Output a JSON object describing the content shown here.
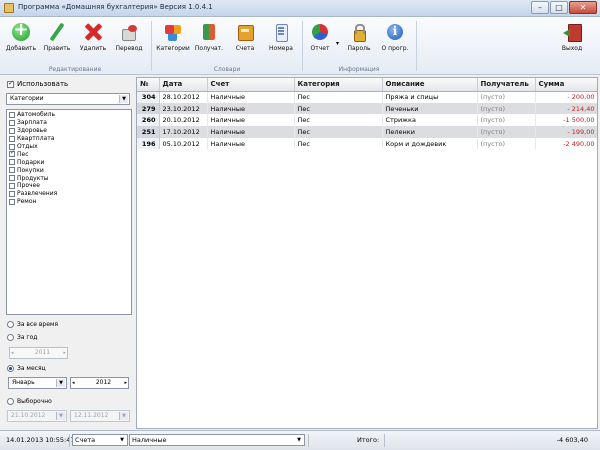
{
  "window": {
    "title": "Программа «Домашняя бухгалтерия» Версия 1.0.4.1",
    "min_label": "–",
    "max_label": "□",
    "close_label": "✕"
  },
  "toolbar": {
    "groups": {
      "editing": "Редактирование",
      "dictionaries": "Словари",
      "info": "Информация"
    },
    "buttons": {
      "add": "Добавить",
      "edit": "Править",
      "delete": "Удалить",
      "transfer": "Перевод",
      "categories": "Категории",
      "payees": "Получат.",
      "accounts": "Счета",
      "numbers": "Номера",
      "report": "Отчет",
      "password": "Пароль",
      "about": "О прогр.",
      "exit": "Выход"
    },
    "dropdown_arrow": "▾"
  },
  "filter": {
    "use_label": "Использовать",
    "use_checked": true,
    "filter_type": "Категории",
    "categories": [
      {
        "name": "Автомобиль",
        "checked": false
      },
      {
        "name": "Зарплата",
        "checked": false
      },
      {
        "name": "Здоровье",
        "checked": false
      },
      {
        "name": "Квартплата",
        "checked": false
      },
      {
        "name": "Отдых",
        "checked": false
      },
      {
        "name": "Пес",
        "checked": true
      },
      {
        "name": "Подарки",
        "checked": false
      },
      {
        "name": "Покупки",
        "checked": false
      },
      {
        "name": "Продукты",
        "checked": false
      },
      {
        "name": "Прочее",
        "checked": false
      },
      {
        "name": "Развлечения",
        "checked": false
      },
      {
        "name": "Ремон",
        "checked": false
      }
    ]
  },
  "period": {
    "all_time": "За все время",
    "year": "За год",
    "year_value": "2011",
    "month": "За месяц",
    "month_value": "Январь",
    "month_year": "2012",
    "custom": "Выборочно",
    "date_from": "21.10.2012",
    "date_to": "12.11.2012",
    "selected": "month"
  },
  "grid": {
    "columns": [
      "№",
      "Дата",
      "Счет",
      "Категория",
      "Описание",
      "Получатель",
      "Сумма"
    ],
    "rows": [
      {
        "num": "304",
        "date": "28.10.2012",
        "account": "Наличные",
        "category": "Пес",
        "desc": "Пряжа и спицы",
        "payee": "(пусто)",
        "amount": "- 200,00",
        "alt": false
      },
      {
        "num": "279",
        "date": "23.10.2012",
        "account": "Наличные",
        "category": "Пес",
        "desc": "Печеньки",
        "payee": "(пусто)",
        "amount": "- 214,40",
        "alt": true
      },
      {
        "num": "260",
        "date": "20.10.2012",
        "account": "Наличные",
        "category": "Пес",
        "desc": "Стрижка",
        "payee": "(пусто)",
        "amount": "-1 500,00",
        "alt": false
      },
      {
        "num": "251",
        "date": "17.10.2012",
        "account": "Наличные",
        "category": "Пес",
        "desc": "Пеленки",
        "payee": "(пусто)",
        "amount": "- 199,00",
        "alt": true
      },
      {
        "num": "196",
        "date": "05.10.2012",
        "account": "Наличные",
        "category": "Пес",
        "desc": "Корм и дождевик",
        "payee": "(пусто)",
        "amount": "-2 490,00",
        "alt": false
      }
    ]
  },
  "status": {
    "datetime": "14.01.2013 10:55:47",
    "account_type": "Счета",
    "account_value": "Наличные",
    "total_label": "Итого:",
    "total_value": "-4 603,40"
  },
  "colors": {
    "negative_amount": "#c42020",
    "alt_row": "#dcdde0"
  }
}
